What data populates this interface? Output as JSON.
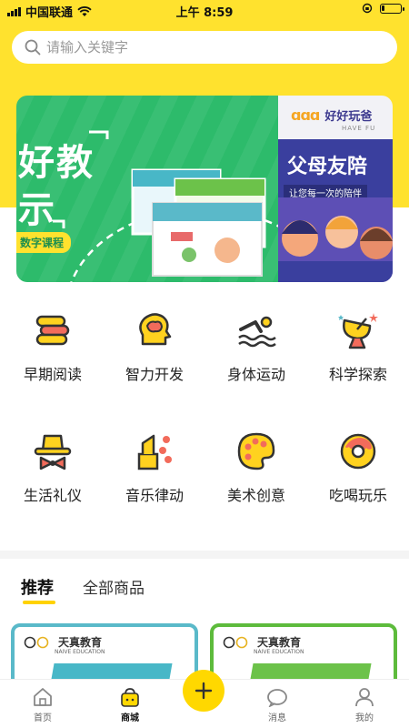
{
  "status_bar": {
    "carrier": "中国联通",
    "time": "上午 8:59"
  },
  "search": {
    "placeholder": "请输入关键字"
  },
  "banner": {
    "slide_a": {
      "headline_1": "好教",
      "headline_2": "示",
      "tag": "数字课程"
    },
    "slide_b": {
      "logo_text": "ɑɑɑ",
      "brand": "好好玩爸",
      "brand_en": "HAVE FU",
      "headline": "父母友陪",
      "subline": "让您每一次的陪伴"
    }
  },
  "categories": [
    {
      "label": "早期阅读",
      "icon": "books-icon"
    },
    {
      "label": "智力开发",
      "icon": "brain-head-icon"
    },
    {
      "label": "身体运动",
      "icon": "swimmer-icon"
    },
    {
      "label": "科学探索",
      "icon": "satellite-dish-icon"
    },
    {
      "label": "生活礼仪",
      "icon": "hat-bowtie-icon"
    },
    {
      "label": "音乐律动",
      "icon": "music-notes-icon"
    },
    {
      "label": "美术创意",
      "icon": "paint-palette-icon"
    },
    {
      "label": "吃喝玩乐",
      "icon": "donut-icon"
    }
  ],
  "tabs": [
    {
      "label": "推荐",
      "active": true
    },
    {
      "label": "全部商品",
      "active": false
    }
  ],
  "products": [
    {
      "brand": "天真教育",
      "brand_en": "NAIVE EDUCATION",
      "accent": "#5AB9C9"
    },
    {
      "brand": "天真教育",
      "brand_en": "NAIVE EDUCATION",
      "accent": "#5DBB3C"
    }
  ],
  "bottom_nav": [
    {
      "label": "首页",
      "icon": "home-icon",
      "active": false
    },
    {
      "label": "商城",
      "icon": "shop-bag-icon",
      "active": true
    },
    {
      "label": "消息",
      "icon": "message-icon",
      "active": false
    },
    {
      "label": "我的",
      "icon": "person-icon",
      "active": false
    }
  ],
  "colors": {
    "brand_yellow": "#FFE22E",
    "banner_green": "#2DBB6B",
    "banner_navy": "#3A3F9E"
  }
}
